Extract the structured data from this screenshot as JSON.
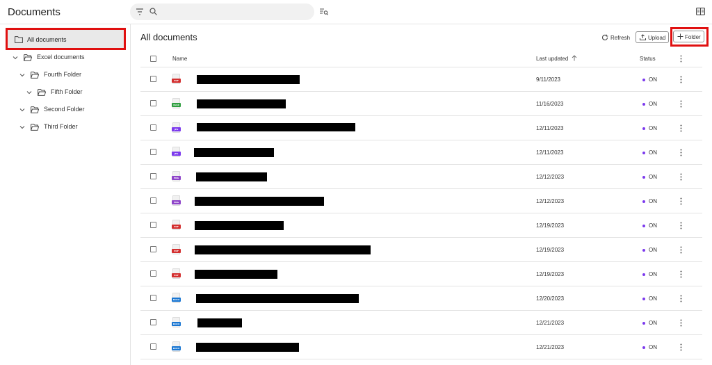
{
  "app": {
    "title": "Documents"
  },
  "search": {
    "placeholder": "",
    "value": ""
  },
  "colors": {
    "highlight": "#e01010",
    "status_on": "#7c3aed",
    "pdf": "#d32f2f",
    "xlsx": "#2e9e3f",
    "jpg": "#7c3aed",
    "png": "#8e44c9",
    "docx": "#1976d2"
  },
  "sidebar": {
    "items": [
      {
        "label": "All documents",
        "level": 0,
        "selected": true,
        "icon": "folder-icon"
      },
      {
        "label": "Excel documents",
        "level": 0,
        "expanded": true,
        "icon": "folder-open-icon"
      },
      {
        "label": "Fourth Folder",
        "level": 1,
        "expanded": true,
        "icon": "folder-open-icon"
      },
      {
        "label": "Fifth Folder",
        "level": 2,
        "expanded": true,
        "icon": "folder-open-icon"
      },
      {
        "label": "Second Folder",
        "level": 1,
        "expanded": true,
        "icon": "folder-open-icon"
      },
      {
        "label": "Third Folder",
        "level": 1,
        "expanded": true,
        "icon": "folder-open-icon"
      }
    ]
  },
  "main": {
    "title": "All documents",
    "actions": {
      "refresh": "Refresh",
      "upload": "Upload",
      "folder": "Folder"
    },
    "columns": {
      "name": "Name",
      "last_updated": "Last updated",
      "status": "Status"
    },
    "rows": [
      {
        "type": "PDF",
        "name": "",
        "date": "9/11/2023",
        "status": "ON"
      },
      {
        "type": "XLSX",
        "name": "",
        "date": "11/16/2023",
        "status": "ON"
      },
      {
        "type": "JPG",
        "name": "",
        "date": "12/11/2023",
        "status": "ON"
      },
      {
        "type": "JPG",
        "name": "",
        "date": "12/11/2023",
        "status": "ON"
      },
      {
        "type": "PNG",
        "name": "",
        "date": "12/12/2023",
        "status": "ON"
      },
      {
        "type": "PNG",
        "name": "",
        "date": "12/12/2023",
        "status": "ON"
      },
      {
        "type": "PDF",
        "name": "",
        "date": "12/19/2023",
        "status": "ON"
      },
      {
        "type": "PDF",
        "name": "",
        "date": "12/19/2023",
        "status": "ON"
      },
      {
        "type": "PDF",
        "name": "",
        "date": "12/19/2023",
        "status": "ON"
      },
      {
        "type": "DOCX",
        "name": "",
        "date": "12/20/2023",
        "status": "ON"
      },
      {
        "type": "DOCX",
        "name": "",
        "date": "12/21/2023",
        "status": "ON"
      },
      {
        "type": "DOCX",
        "name": "",
        "date": "12/21/2023",
        "status": "ON"
      }
    ]
  }
}
